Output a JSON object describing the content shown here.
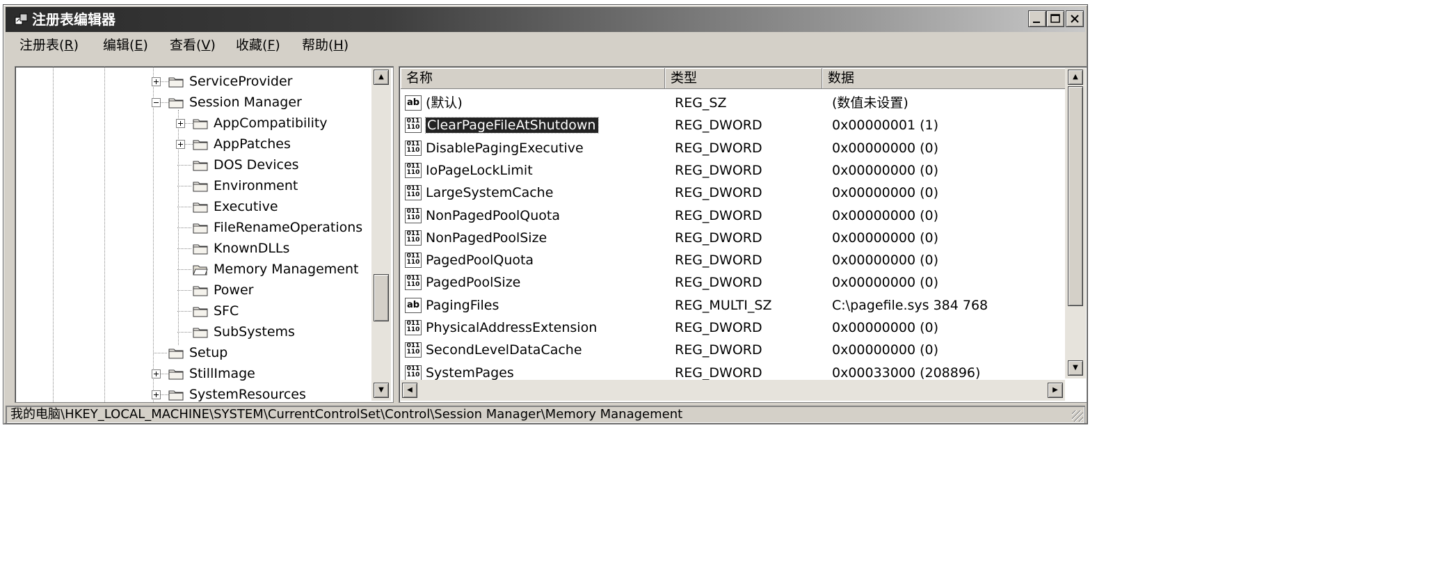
{
  "window": {
    "title": "注册表编辑器",
    "min_glyph": "_",
    "max_glyph": "□",
    "close_glyph": "×"
  },
  "menu": [
    {
      "label": "注册表",
      "key": "R"
    },
    {
      "label": "编辑",
      "key": "E"
    },
    {
      "label": "查看",
      "key": "V"
    },
    {
      "label": "收藏",
      "key": "F"
    },
    {
      "label": "帮助",
      "key": "H"
    }
  ],
  "tree": {
    "items": [
      {
        "label": "ServiceProvider",
        "expander": "plus"
      },
      {
        "label": "Session Manager",
        "expander": "minus"
      },
      {
        "label": "AppCompatibility",
        "expander": "plus"
      },
      {
        "label": "AppPatches",
        "expander": "plus"
      },
      {
        "label": "DOS Devices",
        "expander": "none"
      },
      {
        "label": "Environment",
        "expander": "none"
      },
      {
        "label": "Executive",
        "expander": "none"
      },
      {
        "label": "FileRenameOperations",
        "expander": "none"
      },
      {
        "label": "KnownDLLs",
        "expander": "none"
      },
      {
        "label": "Memory Management",
        "expander": "none",
        "open": true
      },
      {
        "label": "Power",
        "expander": "none"
      },
      {
        "label": "SFC",
        "expander": "none"
      },
      {
        "label": "SubSystems",
        "expander": "none"
      },
      {
        "label": "Setup",
        "expander": "none"
      },
      {
        "label": "StillImage",
        "expander": "plus"
      },
      {
        "label": "SystemResources",
        "expander": "plus"
      }
    ]
  },
  "list": {
    "columns": [
      "名称",
      "类型",
      "数据"
    ],
    "rows": [
      {
        "name": "(默认)",
        "type": "REG_SZ",
        "data": "(数值未设置)",
        "icon": "ab"
      },
      {
        "name": "ClearPageFileAtShutdown",
        "type": "REG_DWORD",
        "data": "0x00000001 (1)",
        "icon": "bin",
        "selected": true
      },
      {
        "name": "DisablePagingExecutive",
        "type": "REG_DWORD",
        "data": "0x00000000 (0)",
        "icon": "bin"
      },
      {
        "name": "IoPageLockLimit",
        "type": "REG_DWORD",
        "data": "0x00000000 (0)",
        "icon": "bin"
      },
      {
        "name": "LargeSystemCache",
        "type": "REG_DWORD",
        "data": "0x00000000 (0)",
        "icon": "bin"
      },
      {
        "name": "NonPagedPoolQuota",
        "type": "REG_DWORD",
        "data": "0x00000000 (0)",
        "icon": "bin"
      },
      {
        "name": "NonPagedPoolSize",
        "type": "REG_DWORD",
        "data": "0x00000000 (0)",
        "icon": "bin"
      },
      {
        "name": "PagedPoolQuota",
        "type": "REG_DWORD",
        "data": "0x00000000 (0)",
        "icon": "bin"
      },
      {
        "name": "PagedPoolSize",
        "type": "REG_DWORD",
        "data": "0x00000000 (0)",
        "icon": "bin"
      },
      {
        "name": "PagingFiles",
        "type": "REG_MULTI_SZ",
        "data": "C:\\pagefile.sys 384 768",
        "icon": "ab"
      },
      {
        "name": "PhysicalAddressExtension",
        "type": "REG_DWORD",
        "data": "0x00000000 (0)",
        "icon": "bin"
      },
      {
        "name": "SecondLevelDataCache",
        "type": "REG_DWORD",
        "data": "0x00000000 (0)",
        "icon": "bin"
      },
      {
        "name": "SystemPages",
        "type": "REG_DWORD",
        "data": "0x00033000 (208896)",
        "icon": "bin"
      }
    ]
  },
  "status": {
    "path": "我的电脑\\HKEY_LOCAL_MACHINE\\SYSTEM\\CurrentControlSet\\Control\\Session Manager\\Memory Management"
  },
  "icons": {
    "string_value": "ab",
    "binary_value": "011\n110"
  },
  "colors": {
    "selection": "#222222",
    "window_face": "#d4d0c8"
  }
}
